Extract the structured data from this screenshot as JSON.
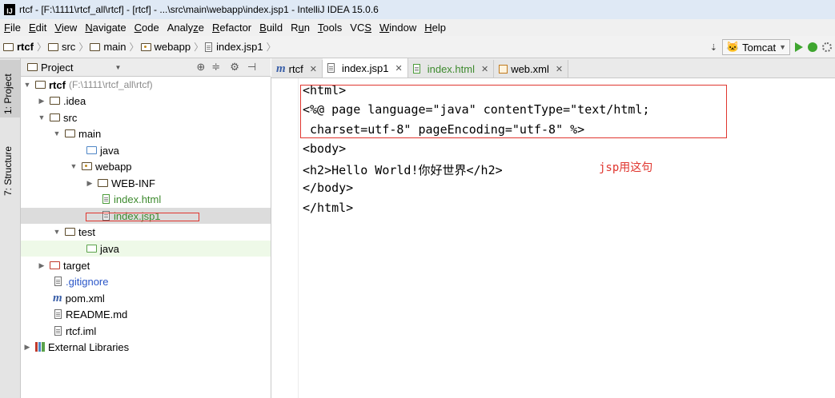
{
  "window": {
    "title": "rtcf - [F:\\1111\\rtcf_all\\rtcf] - [rtcf] - ...\\src\\main\\webapp\\index.jsp1 - IntelliJ IDEA 15.0.6"
  },
  "menu": [
    {
      "pre": "",
      "u": "F",
      "post": "ile"
    },
    {
      "pre": "",
      "u": "E",
      "post": "dit"
    },
    {
      "pre": "",
      "u": "V",
      "post": "iew"
    },
    {
      "pre": "",
      "u": "N",
      "post": "avigate"
    },
    {
      "pre": "",
      "u": "C",
      "post": "ode"
    },
    {
      "pre": "Analy",
      "u": "z",
      "post": "e"
    },
    {
      "pre": "",
      "u": "R",
      "post": "efactor"
    },
    {
      "pre": "",
      "u": "B",
      "post": "uild"
    },
    {
      "pre": "R",
      "u": "u",
      "post": "n"
    },
    {
      "pre": "",
      "u": "T",
      "post": "ools"
    },
    {
      "pre": "VC",
      "u": "S",
      "post": ""
    },
    {
      "pre": "",
      "u": "W",
      "post": "indow"
    },
    {
      "pre": "",
      "u": "H",
      "post": "elp"
    }
  ],
  "breadcrumb": [
    "rtcf",
    "src",
    "main",
    "webapp",
    "index.jsp1"
  ],
  "run_config": "Tomcat",
  "sidebar": {
    "project_tab": "1: Project",
    "structure_tab": "7: Structure"
  },
  "project_panel": {
    "title": "Project"
  },
  "tree": {
    "root": "rtcf",
    "root_path": "(F:\\1111\\rtcf_all\\rtcf)",
    "idea": ".idea",
    "src": "src",
    "main": "main",
    "java": "java",
    "webapp": "webapp",
    "webinf": "WEB-INF",
    "index_html": "index.html",
    "index_jsp1": "index.jsp1",
    "test": "test",
    "test_java": "java",
    "target": "target",
    "gitignore": ".gitignore",
    "pom": "pom.xml",
    "readme": "README.md",
    "iml": "rtcf.iml",
    "ext_libs": "External Libraries"
  },
  "tabs": [
    "rtcf",
    "index.jsp1",
    "index.html",
    "web.xml"
  ],
  "code": [
    "<html>",
    "<%@ page language=\"java\" contentType=\"text/html;",
    " charset=utf-8\" pageEncoding=\"utf-8\" %>",
    "<body>",
    "<h2>Hello World!你好世界</h2>",
    "</body>",
    "</html>"
  ],
  "annotation": "jsp用这句",
  "colors": {
    "accent_red": "#e0362f",
    "caret_line": "#fffae3",
    "green": "#3ea52f"
  }
}
